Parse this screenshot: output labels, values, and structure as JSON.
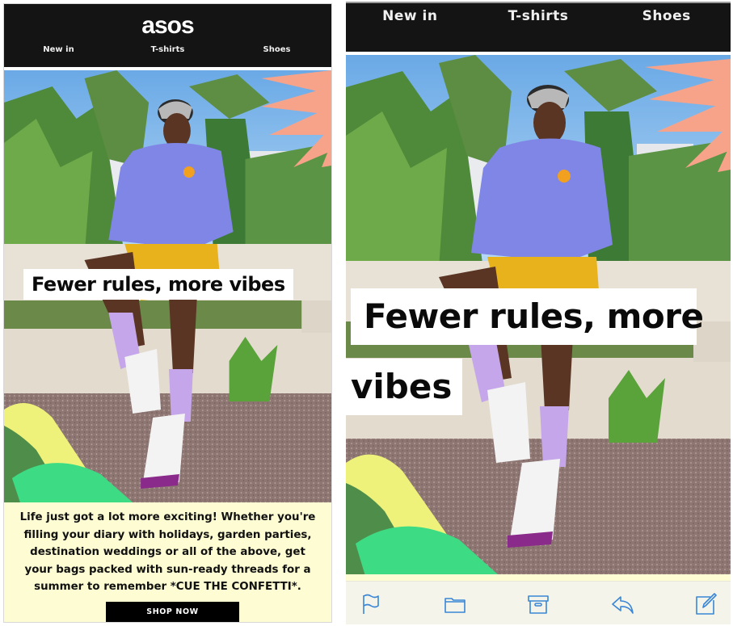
{
  "left_email": {
    "brand_logo": "asos",
    "nav": [
      "New in",
      "T-shirts",
      "Shoes"
    ],
    "hero_headline": "Fewer rules, more vibes",
    "body_text": "Life just got a lot more exciting! Whether you're filling your diary with holidays, garden parties, destination weddings or all of the above, get your bags packed with sun-ready threads for a summer to remember *CUE THE CONFETTI*.",
    "cta_label": "SHOP NOW"
  },
  "right_email": {
    "nav": [
      "New in",
      "T-shirts",
      "Shoes"
    ],
    "hero_headline_line1": "Fewer rules, more",
    "hero_headline_line2": "vibes",
    "toolbar": [
      {
        "icon": "flag-icon",
        "label": "Flag"
      },
      {
        "icon": "folder-icon",
        "label": "Move to folder"
      },
      {
        "icon": "archive-icon",
        "label": "Archive"
      },
      {
        "icon": "reply-icon",
        "label": "Reply"
      },
      {
        "icon": "compose-icon",
        "label": "Compose"
      }
    ]
  },
  "colors": {
    "header_bg": "#141414",
    "copy_bg": "#fdfcd2",
    "cta_bg": "#000000",
    "toolbar_icon": "#3a86d6",
    "toolbar_bg": "#f4f4ea",
    "sky": "#7fb8ea",
    "jacket": "#7f86e6",
    "shorts": "#e8b21c",
    "socks": "#c5a6ea",
    "accent_coral": "#f7a38a",
    "accent_lime": "#eef27a",
    "accent_green": "#3ddc84"
  }
}
